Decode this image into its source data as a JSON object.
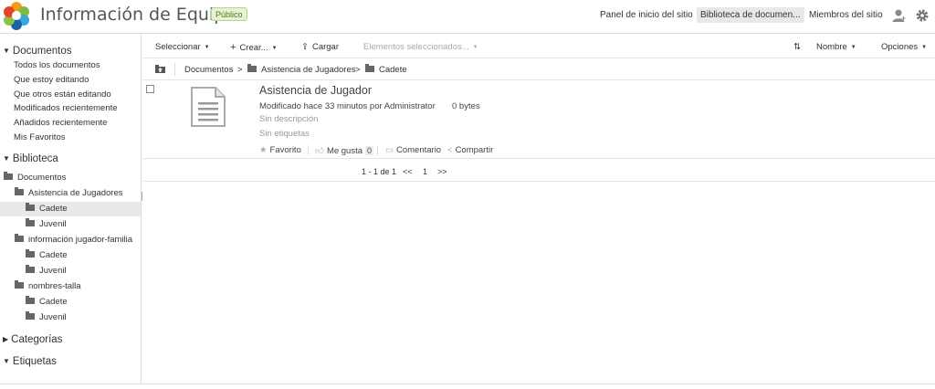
{
  "header": {
    "site_title": "Información de Equipos",
    "visibility_badge": "Público",
    "nav": {
      "dashboard": "Panel de inicio del sitio",
      "library": "Biblioteca de documen...",
      "members": "Miembros del sitio"
    },
    "icons": [
      "alfresco-logo",
      "user-icon",
      "gear-icon"
    ]
  },
  "sidebar": {
    "documents_heading": "Documentos",
    "document_filters": [
      "Todos los documentos",
      "Que estoy editando",
      "Que otros están editando",
      "Modificados recientemente",
      "Añadidos recientemente",
      "Mis Favoritos"
    ],
    "library_heading": "Biblioteca",
    "tree": {
      "root": "Documentos",
      "folders": [
        {
          "label": "Asistencia de Jugadores",
          "children": [
            "Cadete",
            "Juvenil"
          ]
        },
        {
          "label": "información jugador-familia",
          "children": [
            "Cadete",
            "Juvenil"
          ]
        },
        {
          "label": "nombres-talla",
          "children": [
            "Cadete",
            "Juvenil"
          ]
        }
      ],
      "selected": "Asistencia de Jugadores / Cadete"
    },
    "categories_heading": "Categorías",
    "tags_heading": "Etiquetas"
  },
  "toolbar": {
    "select": "Seleccionar",
    "create": "Crear...",
    "upload": "Cargar",
    "selected_items": "Elementos seleccionados...",
    "sort": "Nombre",
    "options": "Opciones"
  },
  "breadcrumb": {
    "items": [
      "Documentos",
      "Asistencia de Jugadores",
      "Cadete"
    ],
    "separator": ">"
  },
  "document": {
    "title": "Asistencia de Jugador",
    "modified": "Modificado hace 33 minutos por Administrator",
    "size": "0 bytes",
    "description": "Sin descripción",
    "tags": "Sin etiquetas",
    "actions": {
      "favorite": "Favorito",
      "like": "Me gusta",
      "like_count": "0",
      "comment": "Comentario",
      "share": "Compartir"
    }
  },
  "pagination": {
    "range": "1 - 1 de 1",
    "first": "<<",
    "page": "1",
    "last": ">>"
  },
  "colors": {
    "badge_bg": "#e7f2d4",
    "badge_text": "#4c7a12",
    "selected_bg": "#e9e9e9",
    "border": "#dcdcdc"
  }
}
